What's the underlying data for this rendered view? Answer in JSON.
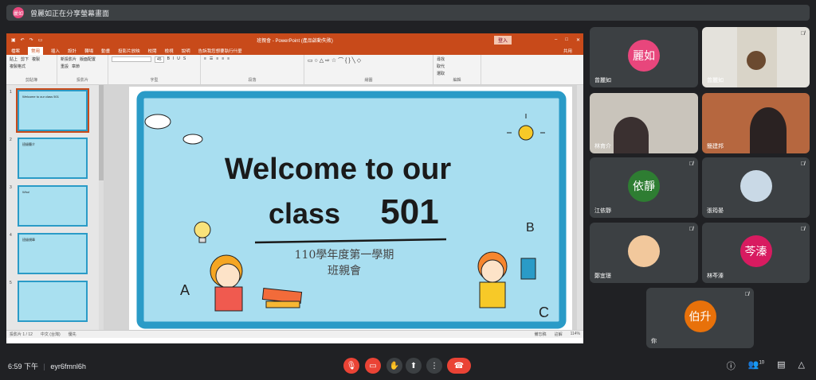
{
  "topbar": {
    "avatar_text": "麗如",
    "message": "曾麗如正在分享螢幕畫面"
  },
  "ppt": {
    "title": "班親會 - PowerPoint (產品啟動失敗)",
    "user": "登入",
    "tabs": [
      "檔案",
      "常用",
      "插入",
      "設計",
      "轉場",
      "動畫",
      "投影片放映",
      "校閱",
      "檢視",
      "說明",
      "告訴我您想要執行什麼"
    ],
    "active_tab": "常用",
    "share": "共用",
    "groups": [
      "剪貼簿",
      "投影片",
      "字型",
      "段落",
      "繪圖",
      "編輯"
    ],
    "clipboard": [
      "貼上",
      "剪下",
      "複製",
      "複製格式"
    ],
    "slides_group": [
      "新投影片",
      "版面配置",
      "重設",
      "章節"
    ],
    "edit_group": [
      "尋找",
      "取代",
      "選取"
    ],
    "font_size": "45",
    "status_left": "投影片 1 / 12",
    "status_lang": "中文 (台灣)",
    "status_access": "優先",
    "status_notes": "備忘稿",
    "status_comments": "註解",
    "zoom": "114%"
  },
  "slide": {
    "line1": "Welcome to our",
    "line2": "class",
    "num": "501",
    "sub1": "110學年度第一學期",
    "sub2": "班親會",
    "a": "A",
    "b": "B",
    "c": "C"
  },
  "thumbs": [
    {
      "num": "1",
      "text": "Welcome to our class 501"
    },
    {
      "num": "2",
      "text": "班級簡介"
    },
    {
      "num": "3",
      "text": "Who!"
    },
    {
      "num": "4",
      "text": "班級規章"
    },
    {
      "num": "5",
      "text": ""
    }
  ],
  "tiles": [
    {
      "name": "曾麗如",
      "initials": "麗如",
      "color": "#e8467c"
    },
    {
      "name": "曾麗如",
      "initials": "",
      "color": "#7a5a40"
    },
    {
      "name": "林育介",
      "initials": "",
      "color": "#8a7a6a"
    },
    {
      "name": "簡建邦",
      "initials": "",
      "color": "#9a4a3a"
    },
    {
      "name": "江依靜",
      "initials": "依靜",
      "color": "#2e7d32"
    },
    {
      "name": "張筠晏",
      "initials": "",
      "color": "#c9d9e6"
    },
    {
      "name": "鄭宜璟",
      "initials": "",
      "color": "#f2c89c"
    },
    {
      "name": "林芩溱",
      "initials": "芩溱",
      "color": "#d81b60"
    },
    {
      "name": "你",
      "initials": "伯升",
      "color": "#e8710a"
    }
  ],
  "meeting": {
    "time": "6:59 下午",
    "separator": "|",
    "code": "eyr6fmnl6h",
    "participants": "10"
  },
  "icons": [
    "mic-off-icon",
    "camera-off-icon",
    "hand-icon",
    "present-icon",
    "more-icon",
    "hangup-icon",
    "info-icon",
    "people-icon",
    "chat-icon",
    "activities-icon"
  ]
}
